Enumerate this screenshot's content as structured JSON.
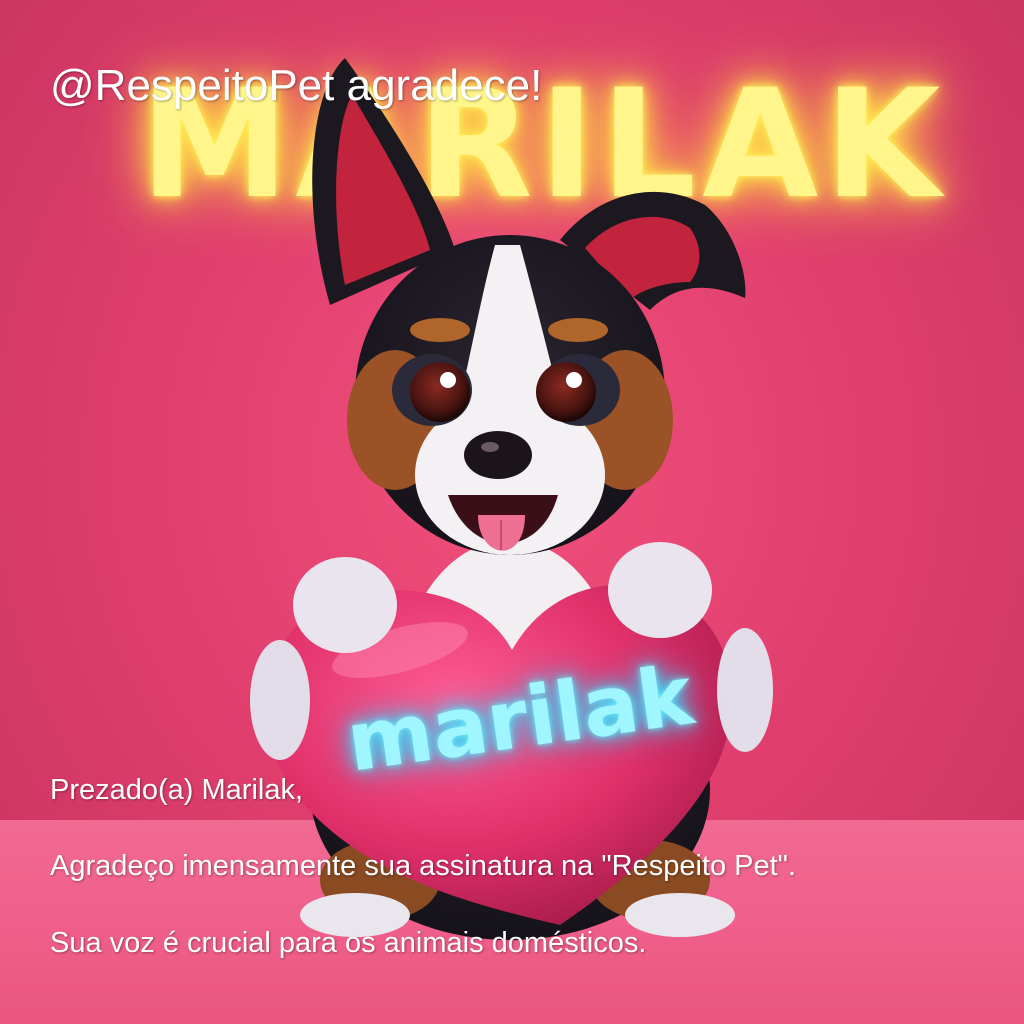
{
  "scene": {
    "neon_sign_text": "MARILAK",
    "heart_text": "marilak",
    "background_color": "#e2406f",
    "neon_sign_color": "#fff58a",
    "heart_color": "#e8346f",
    "heart_text_color": "#9ff6ff"
  },
  "overlay": {
    "headline": "@RespeitoPet agradece!",
    "greeting": "Prezado(a) Marilak,",
    "thanks": "Agradeço imensamente sua assinatura na \"Respeito Pet\".",
    "closing": "Sua voz é crucial para os animais domésticos."
  }
}
